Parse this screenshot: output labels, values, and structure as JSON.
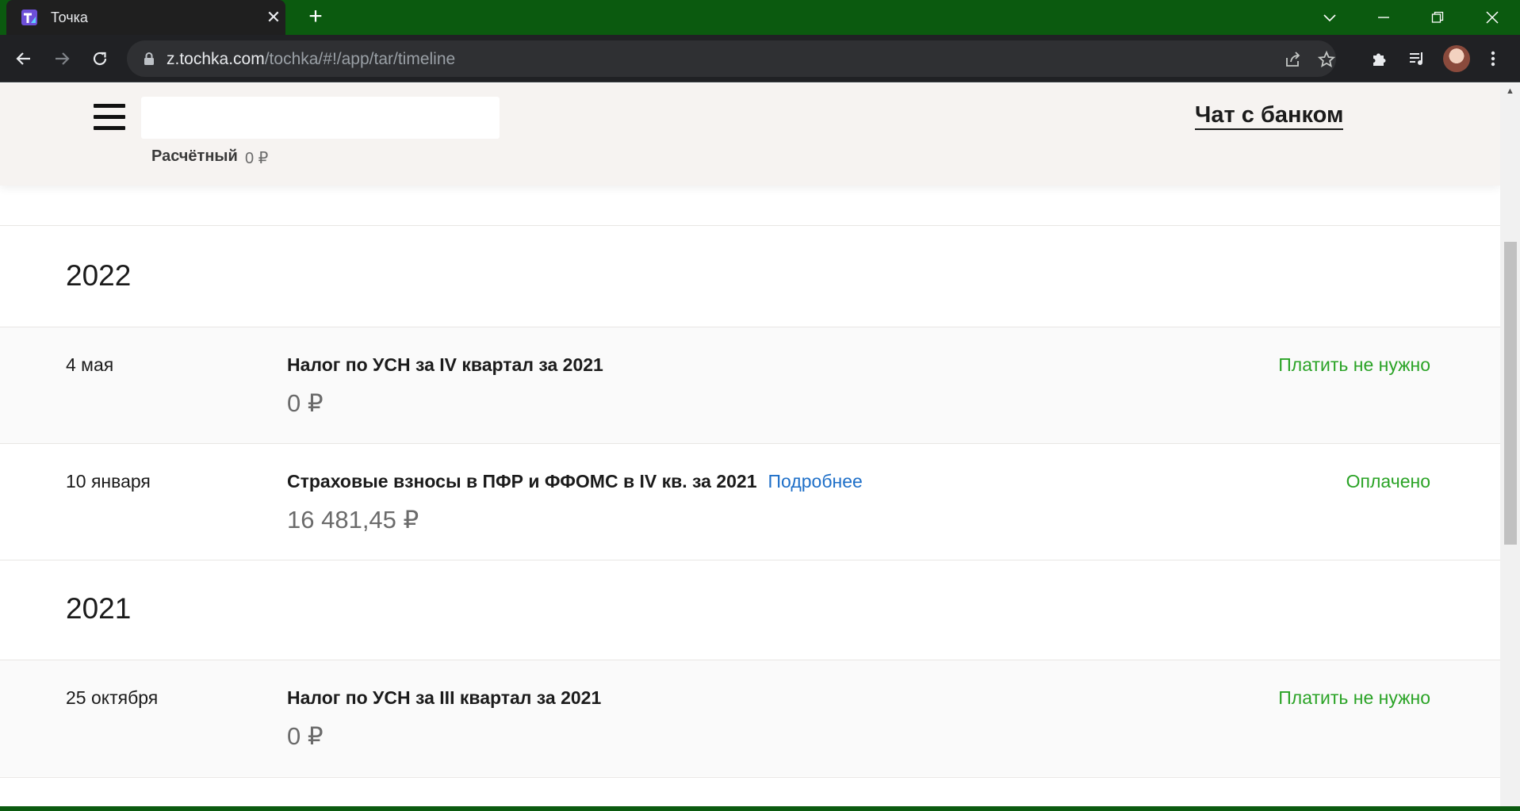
{
  "browser": {
    "tab_title": "Точка",
    "url_host": "z.tochka.com",
    "url_path": "/tochka/#!/app/tar/timeline"
  },
  "header": {
    "account_label": "Расчётный",
    "account_balance": "0 ₽",
    "chat_label": "Чат с банком"
  },
  "timeline": {
    "years": [
      {
        "year": "2022",
        "items": [
          {
            "date": "4 мая",
            "title": "Налог по УСН за IV квартал за 2021",
            "more": "",
            "amount": "0 ₽",
            "status": "Платить не нужно"
          },
          {
            "date": "10 января",
            "title": "Страховые взносы в ПФР и ФФОМС в IV кв. за 2021",
            "more": "Подробнее",
            "amount": "16 481,45 ₽",
            "status": "Оплачено"
          }
        ]
      },
      {
        "year": "2021",
        "items": [
          {
            "date": "25 октября",
            "title": "Налог по УСН за III квартал за 2021",
            "more": "",
            "amount": "0 ₽",
            "status": "Платить не нужно"
          }
        ]
      }
    ]
  },
  "colors": {
    "status_green": "#2aa326",
    "link_blue": "#1e6fc8",
    "titlebar_green": "#0b5a0f"
  }
}
